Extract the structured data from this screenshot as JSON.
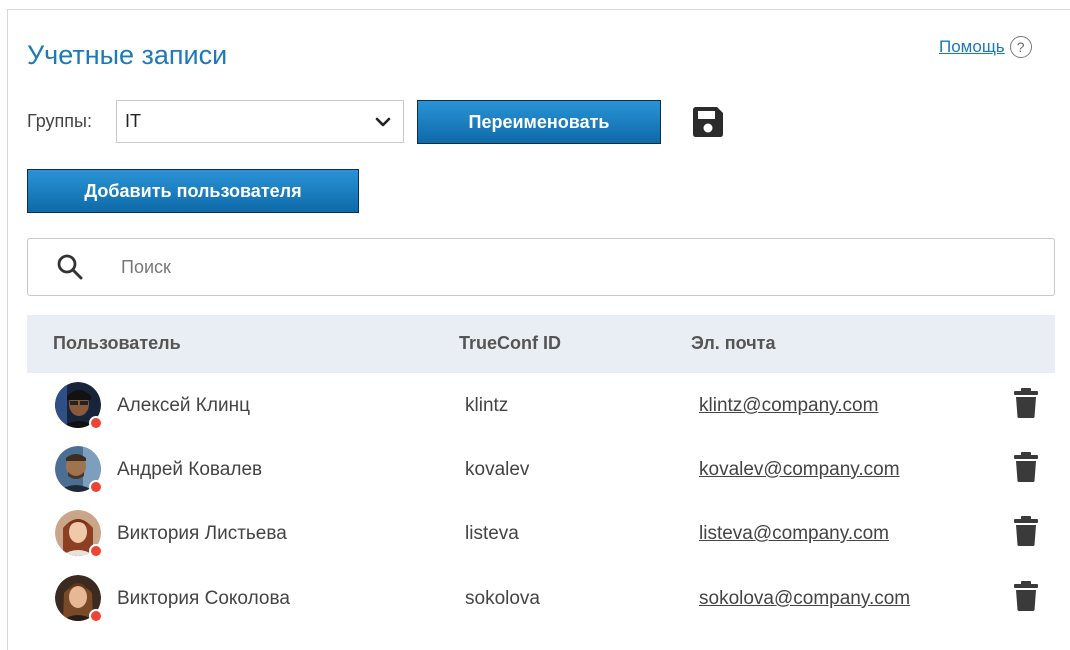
{
  "page": {
    "title": "Учетные записи"
  },
  "help": {
    "label": "Помощь",
    "icon": "question-circle-icon",
    "glyph": "?"
  },
  "toolbar": {
    "groups_label": "Группы:",
    "group_selected": "IT",
    "rename_label": "Переименовать",
    "add_user_label": "Добавить пользователя",
    "save_icon": "floppy-disk-icon"
  },
  "search": {
    "placeholder": "Поиск",
    "value": ""
  },
  "table": {
    "headers": {
      "user": "Пользователь",
      "id": "TrueConf ID",
      "email": "Эл. почта"
    },
    "rows": [
      {
        "name": "Алексей Клинц",
        "id": "klintz",
        "email": "klintz@company.com",
        "status": "offline"
      },
      {
        "name": "Андрей Ковалев",
        "id": "kovalev",
        "email": "kovalev@company.com",
        "status": "offline"
      },
      {
        "name": "Виктория Листьева",
        "id": "listeva",
        "email": "listeva@company.com",
        "status": "offline"
      },
      {
        "name": "Виктория Соколова",
        "id": "sokolova",
        "email": "sokolova@company.com",
        "status": "offline"
      }
    ]
  },
  "colors": {
    "accent": "#1b7ab8",
    "button_top": "#2a93d6",
    "button_bottom": "#0e6aa8",
    "header_bg": "#e8eef3",
    "status_offline": "#ee4433"
  }
}
